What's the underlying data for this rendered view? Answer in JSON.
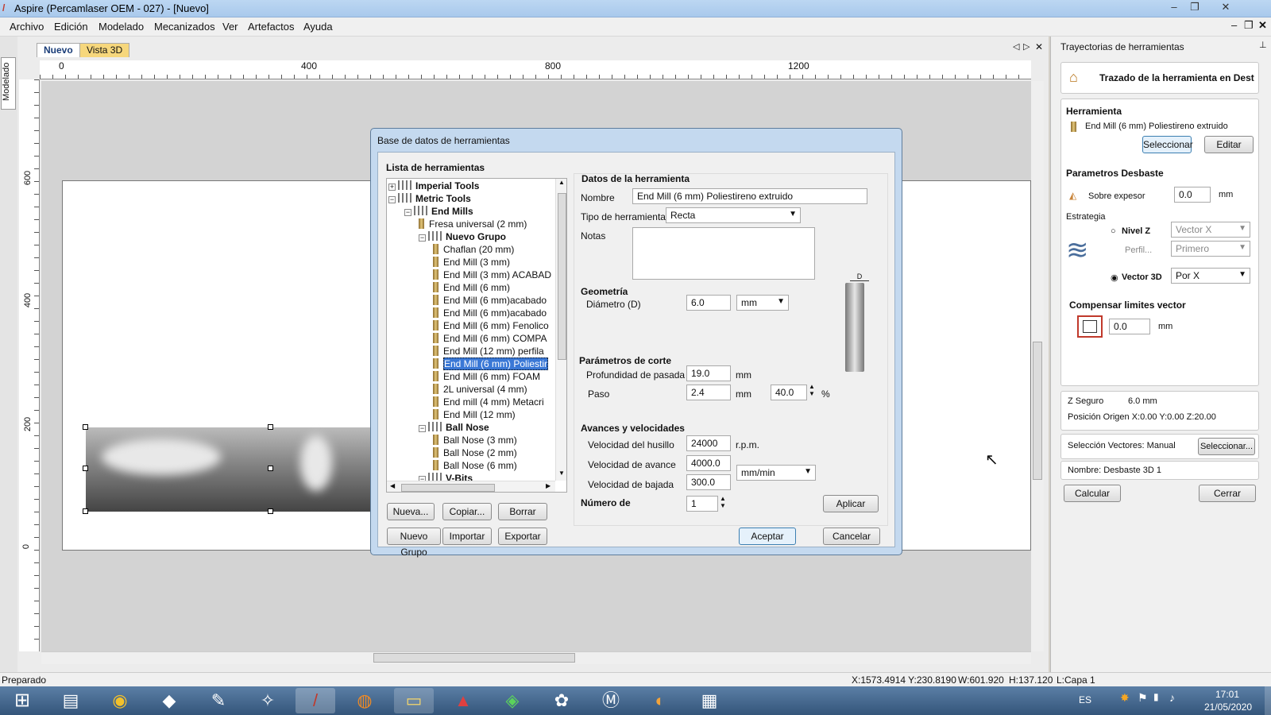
{
  "window": {
    "title": "Aspire (Percamlaser OEM - 027) - [Nuevo]"
  },
  "menu": [
    "Archivo",
    "Edición",
    "Modelado",
    "Mecanizados",
    "Ver",
    "Artefactos",
    "Ayuda"
  ],
  "left_tab": "Modelado",
  "doc_tabs": [
    "Nuevo",
    "Vista 3D"
  ],
  "ruler": {
    "top": [
      "0",
      "400",
      "800",
      "1200"
    ],
    "left": [
      "600",
      "400",
      "200",
      "0"
    ]
  },
  "dialog": {
    "title": "Base de datos de herramientas",
    "list_title": "Lista de herramientas",
    "tree": [
      {
        "label": "Imperial Tools",
        "kind": "root",
        "expander": "+",
        "bold": true
      },
      {
        "label": "Metric Tools",
        "kind": "root",
        "expander": "−",
        "bold": true
      },
      {
        "label": "End Mills",
        "kind": "group",
        "expander": "−",
        "bold": true
      },
      {
        "label": "Fresa universal (2 mm)",
        "kind": "tool"
      },
      {
        "label": "Nuevo Grupo",
        "kind": "group",
        "expander": "−",
        "bold": true
      },
      {
        "label": "Chaflan (20 mm)",
        "kind": "tool"
      },
      {
        "label": "End Mill (3 mm)",
        "kind": "tool"
      },
      {
        "label": "End Mill (3 mm) ACABAD",
        "kind": "tool"
      },
      {
        "label": "End Mill (6 mm)",
        "kind": "tool"
      },
      {
        "label": "End Mill (6 mm)acabado",
        "kind": "tool"
      },
      {
        "label": "End Mill (6 mm)acabado",
        "kind": "tool"
      },
      {
        "label": "End Mill (6 mm) Fenolico",
        "kind": "tool"
      },
      {
        "label": "End Mill (6 mm) COMPA",
        "kind": "tool"
      },
      {
        "label": "End Mill (12 mm) perfila",
        "kind": "tool"
      },
      {
        "label": "End Mill (6 mm) Poliestir",
        "kind": "tool",
        "selected": true
      },
      {
        "label": "End Mill (6 mm) FOAM",
        "kind": "tool"
      },
      {
        "label": "2L universal (4 mm)",
        "kind": "tool"
      },
      {
        "label": "End mill (4 mm) Metacri",
        "kind": "tool"
      },
      {
        "label": "End Mill (12 mm)",
        "kind": "tool"
      },
      {
        "label": "Ball Nose",
        "kind": "group",
        "expander": "−",
        "bold": true
      },
      {
        "label": "Ball Nose (3 mm)",
        "kind": "tool"
      },
      {
        "label": "Ball Nose (2 mm)",
        "kind": "tool"
      },
      {
        "label": "Ball Nose (6 mm)",
        "kind": "tool"
      },
      {
        "label": "V-Bits",
        "kind": "group",
        "expander": "−",
        "bold": true
      }
    ],
    "list_buttons": [
      "Nueva...",
      "Copiar...",
      "Borrar",
      "Nuevo Grupo",
      "Importar",
      "Exportar"
    ],
    "tool_data": {
      "section": "Datos de la herramienta",
      "name_label": "Nombre",
      "name_value": "End Mill (6 mm) Poliestireno extruido",
      "type_label": "Tipo de herramienta",
      "type_value": "Recta",
      "notes_label": "Notas",
      "geom_title": "Geometría",
      "diam_label": "Diámetro (D)",
      "diam_value": "6.0",
      "diam_unit": "mm",
      "cut_title": "Parámetros de corte",
      "depth_label": "Profundidad de pasada",
      "depth_value": "19.0",
      "depth_unit": "mm",
      "step_label": "Paso",
      "step_value": "2.4",
      "step_unit": "mm",
      "step_pct": "40.0",
      "pct_sign": "%",
      "feeds_title": "Avances y velocidades",
      "spindle_label": "Velocidad del husillo",
      "spindle_value": "24000",
      "spindle_unit": "r.p.m.",
      "feed_label": "Velocidad de avance",
      "feed_value": "4000.0",
      "feed_unit": "mm/min",
      "plunge_label": "Velocidad de bajada",
      "plunge_value": "300.0",
      "tool_num_label": "Número de",
      "tool_num_value": "1",
      "diagram_label": "D",
      "apply": "Aplicar"
    },
    "ok": "Aceptar",
    "cancel": "Cancelar"
  },
  "right_panel": {
    "title": "Trayectorias de herramientas",
    "header": "Trazado de la herramienta en Dest",
    "tool_title": "Herramienta",
    "tool_name": "End Mill (6 mm) Poliestireno extruido",
    "select_btn": "Seleccionar",
    "edit_btn": "Editar",
    "rough_title": "Parametros Desbaste",
    "allowance_label": "Sobre expesor",
    "allowance_value": "0.0",
    "allowance_unit": "mm",
    "strategy_label": "Estrategia",
    "z_level": "Nivel Z",
    "z_option": "Vector X",
    "profile_label": "Perfil...",
    "profile_option": "Primero",
    "vector3d": "Vector 3D",
    "vector3d_option": "Por X",
    "comp_title": "Compensar limites vector",
    "comp_value": "0.0",
    "comp_unit": "mm",
    "safe_z": "Z Seguro",
    "safe_z_value": "6.0 mm",
    "origin": "Posición Origen X:0.00 Y:0.00 Z:20.00",
    "vec_sel": "Selección Vectores: Manual",
    "vec_sel_btn": "Seleccionar...",
    "name_line": "Nombre: Desbaste 3D 1",
    "calc": "Calcular",
    "close": "Cerrar"
  },
  "status": {
    "left": "Preparado",
    "coords": "X:1573.4914 Y:230.8190",
    "w": "W:601.920",
    "h": "H:137.120",
    "layer": "L:Capa 1"
  },
  "tray": {
    "lang": "ES",
    "time": "17:01",
    "date": "21/05/2020"
  },
  "icons": {
    "start": "windows-start-icon",
    "chrome": "chrome-icon",
    "firefox": "firefox-icon",
    "explorer": "folder-icon"
  }
}
